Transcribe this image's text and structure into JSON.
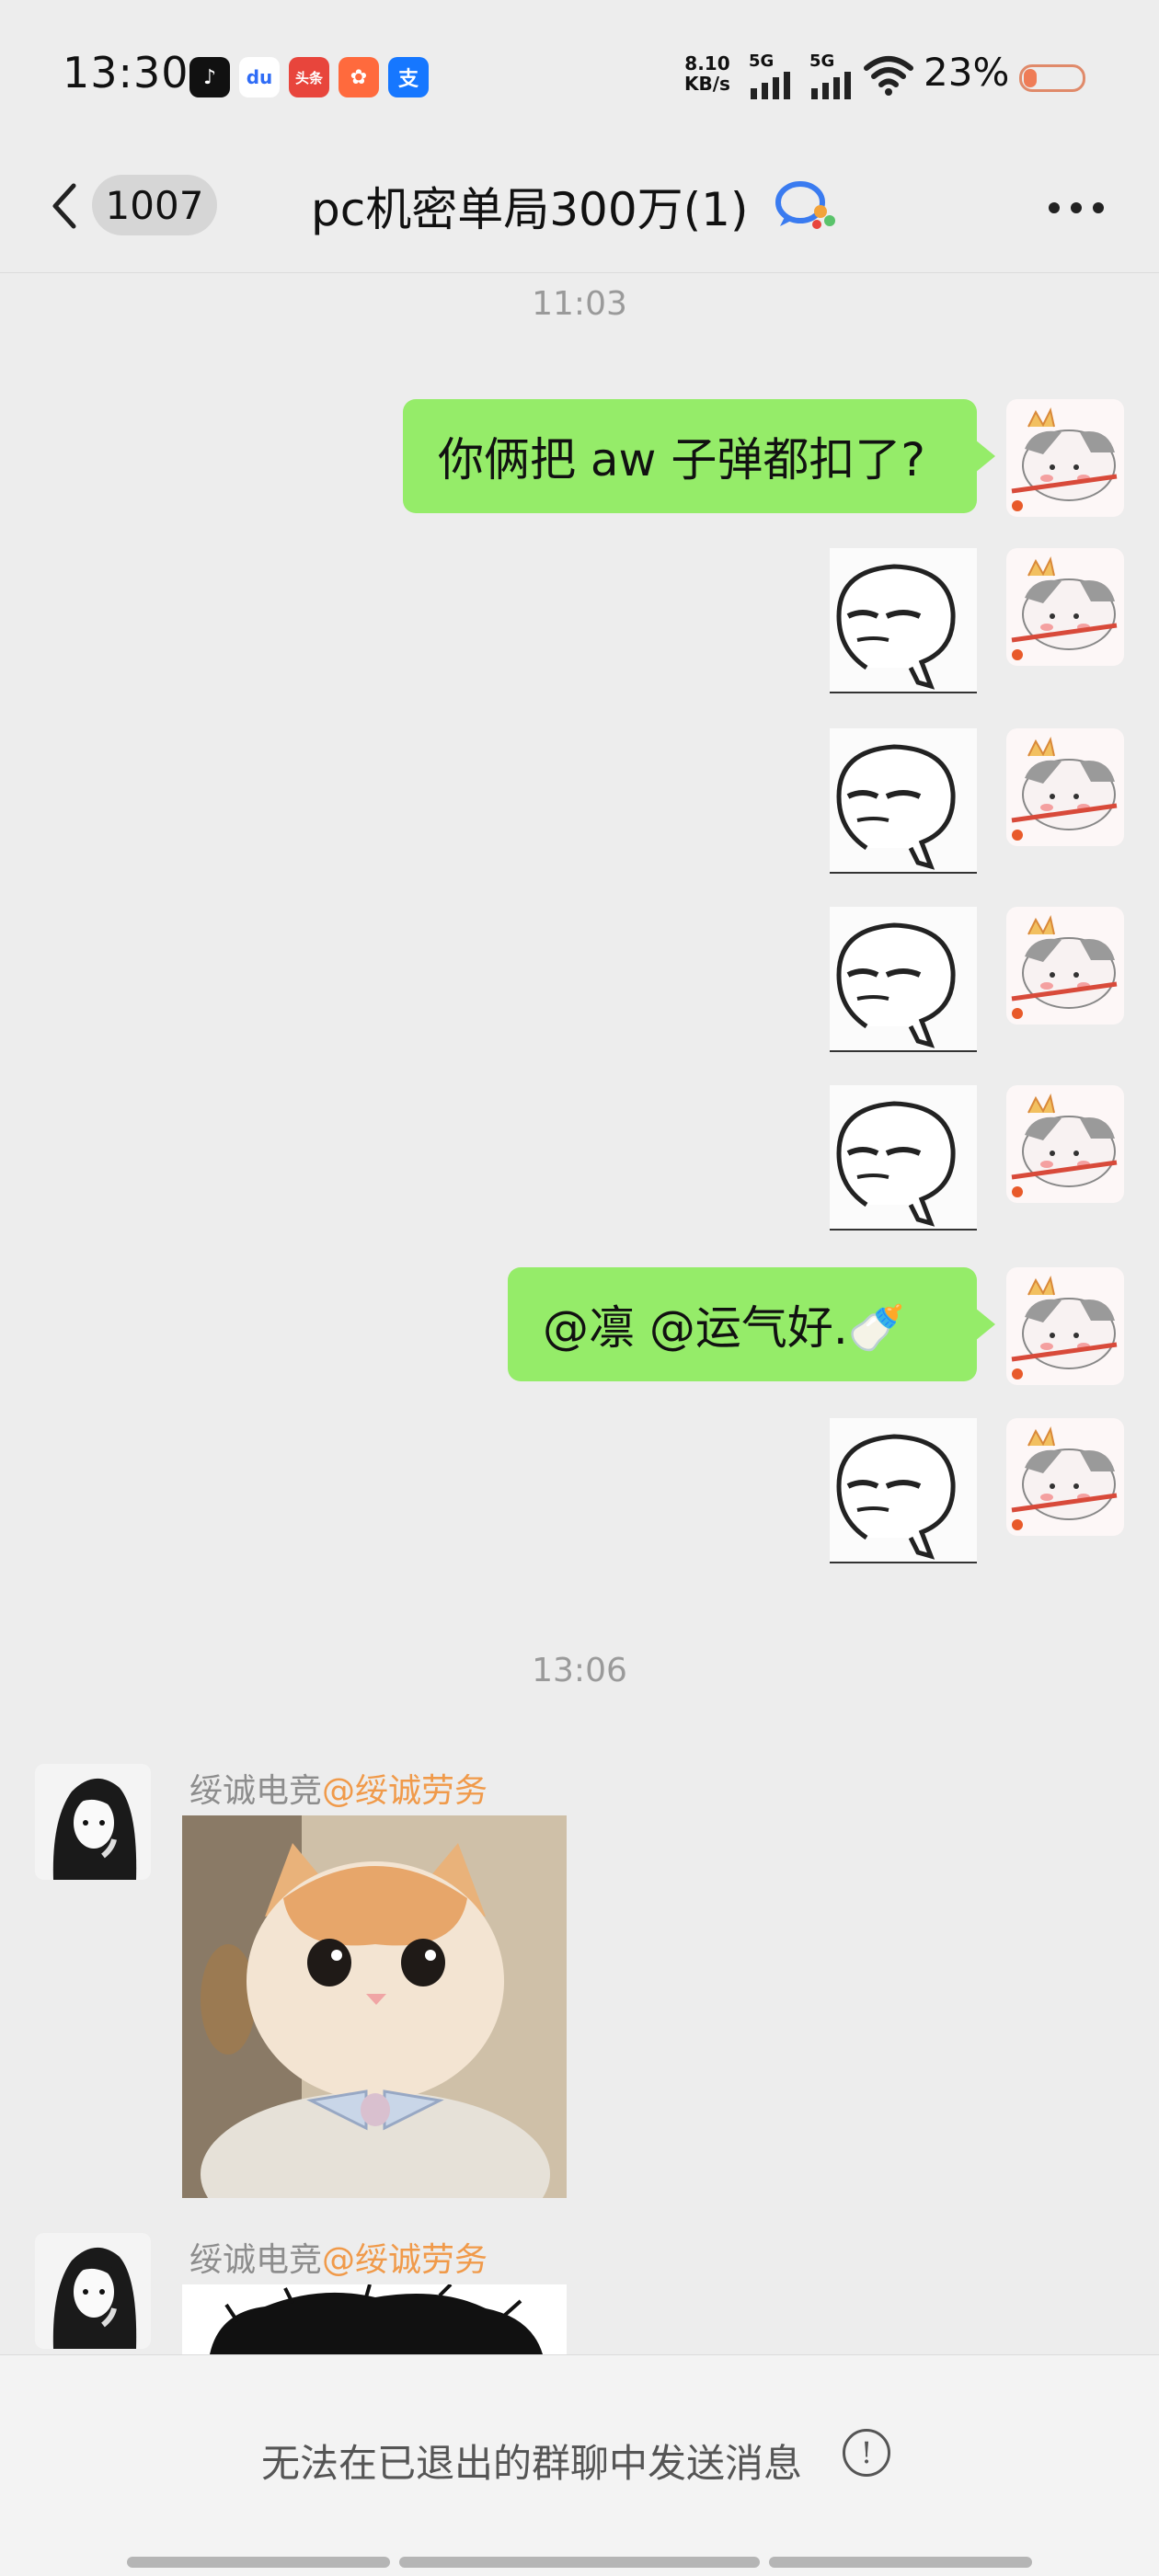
{
  "status_bar": {
    "time": "13:30",
    "apps": [
      {
        "icon": "douyin-icon",
        "glyph": "♪",
        "color": "#111111"
      },
      {
        "icon": "baidu-icon",
        "glyph": "du",
        "color": "#2f6cf6"
      },
      {
        "icon": "toutiao-icon",
        "glyph": "头条",
        "color": "#e8453c"
      },
      {
        "icon": "kuaishou-icon",
        "glyph": "✿",
        "color": "#ff6a3d"
      },
      {
        "icon": "alipay-icon",
        "glyph": "支",
        "color": "#1677ff"
      }
    ],
    "net_speed_value": "8.10",
    "net_speed_unit": "KB/s",
    "signal_1": "5G",
    "signal_2": "5G",
    "battery_percent": "23%",
    "battery_level": 0.23
  },
  "header": {
    "unread_count": "1007",
    "title": "pc机密单局300万(1)"
  },
  "messages": {
    "timestamp_1": "11:03",
    "text_1": "你俩把 aw 子弹都扣了?",
    "text_2": "@凛  @运气好.🍼",
    "timestamp_2": "13:06",
    "sender_1": {
      "name": "绥诚电竞",
      "tag": "@绥诚劳务"
    },
    "sender_2": {
      "name": "绥诚电竞",
      "tag": "@绥诚劳务"
    }
  },
  "footer": {
    "notice": "无法在已退出的群聊中发送消息",
    "info_symbol": "!"
  },
  "colors": {
    "background": "#ededed",
    "bubble_green": "#95ec69",
    "mention_orange": "#f09a4a"
  }
}
